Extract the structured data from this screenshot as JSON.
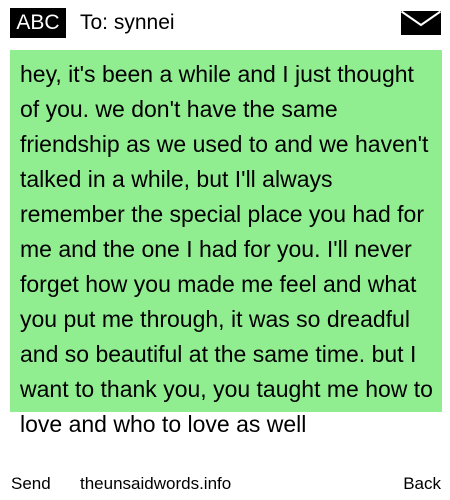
{
  "header": {
    "input_mode": "ABC",
    "recipient": "To: synnei",
    "icons": [
      "envelope-icon"
    ]
  },
  "message": {
    "body": "hey, it's been a while and I just thought of you. we don't have the same friendship as we used to and we haven't talked in a while, but I'll always remember the special place you had for me and the one I had for you. I'll never forget how you made me feel and what you put me through, it was so dreadful and so beautiful at the same time. but I want to thank you, you taught me how to love and who to love as well"
  },
  "softkeys": {
    "left": "Send",
    "center": "theunsaidwords.info",
    "right": "Back"
  },
  "colors": {
    "message_background": "#90ee90",
    "badge_background": "#000000",
    "page_background": "#ffffff"
  }
}
